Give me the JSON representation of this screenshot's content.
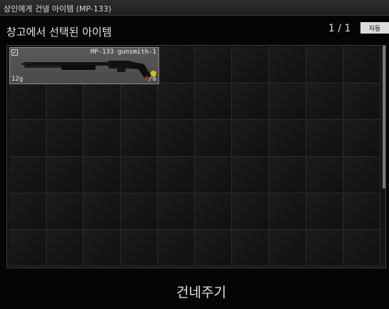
{
  "window": {
    "title": "상인에게 건넬 아이템 (MP-133)"
  },
  "header": {
    "heading": "창고에서 선택된 아이템",
    "pager": "1 / 1",
    "auto_label": "자동"
  },
  "stash": {
    "columns": 10,
    "rows": 6,
    "items": [
      {
        "name": "MP-133 gunsmith-1",
        "weight": "12g",
        "ammo_current": "0",
        "ammo_capacity": "/6",
        "checked": true
      }
    ]
  },
  "footer": {
    "give_label": "건네주기"
  },
  "colors": {
    "background": "#050505",
    "item_bg": "#555555",
    "ammo_empty": "#e0262a",
    "mod_indicator": "#d8c000"
  }
}
